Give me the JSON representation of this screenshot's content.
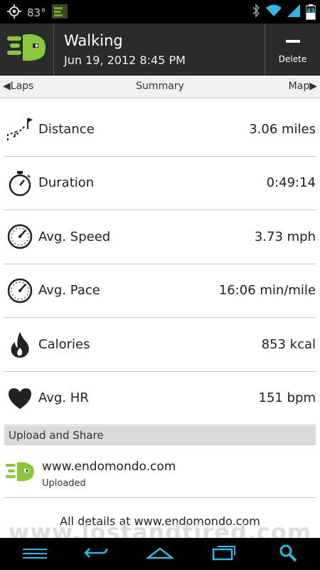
{
  "status_bar": {
    "temperature": "83°",
    "battery": "43"
  },
  "action_bar": {
    "app_icon": "endomondo-logo-icon",
    "title": "Walking",
    "subtitle": "Jun 19, 2012 8:45 PM",
    "delete_label": "Delete"
  },
  "tabs": {
    "left": "Laps",
    "center": "Summary",
    "right": "Map"
  },
  "stats": [
    {
      "icon": "distance-flag-icon",
      "label": "Distance",
      "value": "3.06 miles"
    },
    {
      "icon": "stopwatch-icon",
      "label": "Duration",
      "value": "0:49:14"
    },
    {
      "icon": "speedometer-icon",
      "label": "Avg. Speed",
      "value": "3.73 mph"
    },
    {
      "icon": "speedometer-icon",
      "label": "Avg. Pace",
      "value": "16:06 min/mile"
    },
    {
      "icon": "flame-icon",
      "label": "Calories",
      "value": "853 kcal"
    },
    {
      "icon": "heart-icon",
      "label": "Avg. HR",
      "value": "151 bpm"
    }
  ],
  "upload_section": {
    "header": "Upload and Share",
    "site": "www.endomondo.com",
    "status": "Uploaded"
  },
  "details_link": "All details at www.endomondo.com",
  "watermark": "www.lostandtired.com",
  "colors": {
    "brand_green": "#8cc63f",
    "action_bar": "#2b2b2b",
    "status_blue": "#33b5e5"
  }
}
